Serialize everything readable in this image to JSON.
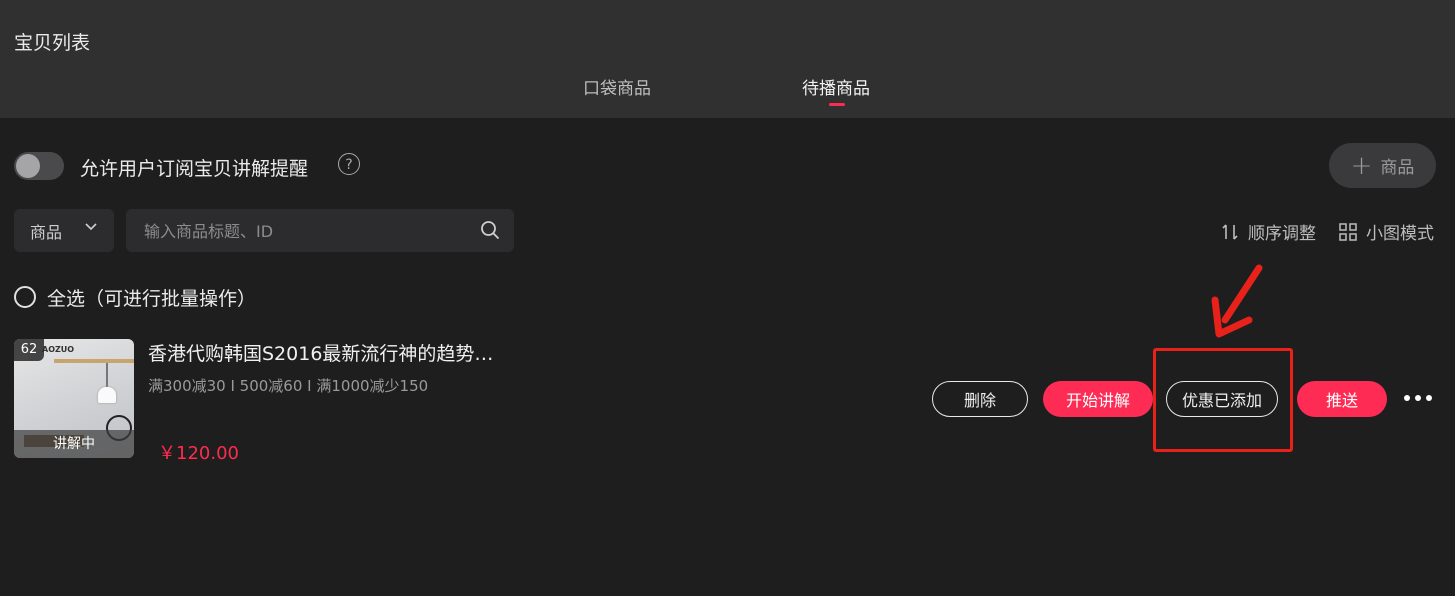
{
  "header": {
    "title": "宝贝列表",
    "tabs": [
      {
        "label": "口袋商品",
        "active": false
      },
      {
        "label": "待播商品",
        "active": true
      }
    ],
    "accent_color": "#fe2c55"
  },
  "settings": {
    "subscribe_toggle_label": "允许用户订阅宝贝讲解提醒",
    "subscribe_toggle_on": false,
    "help_icon": "question-circle-icon",
    "add_product_label": "商品",
    "add_icon": "plus-icon"
  },
  "filter": {
    "category_selected": "商品",
    "search_placeholder": "输入商品标题、ID",
    "search_value": ""
  },
  "tools": {
    "reorder_label": "顺序调整",
    "reorder_icon": "sort-icon",
    "small_view_label": "小图模式",
    "small_view_icon": "grid-icon"
  },
  "select_all": {
    "label": "全选（可进行批量操作）"
  },
  "products": [
    {
      "index": "62",
      "status": "讲解中",
      "title": "香港代购韩国S2016最新流行神的趋势…",
      "promo": "满300减30 I 500减60 I 满1000减少150",
      "price": "￥120.00",
      "actions": {
        "delete": "删除",
        "start_explain": "开始讲解",
        "coupon_added": "优惠已添加",
        "push": "推送"
      }
    }
  ],
  "annotation": {
    "color": "#e8211b",
    "target": "优惠已添加"
  }
}
